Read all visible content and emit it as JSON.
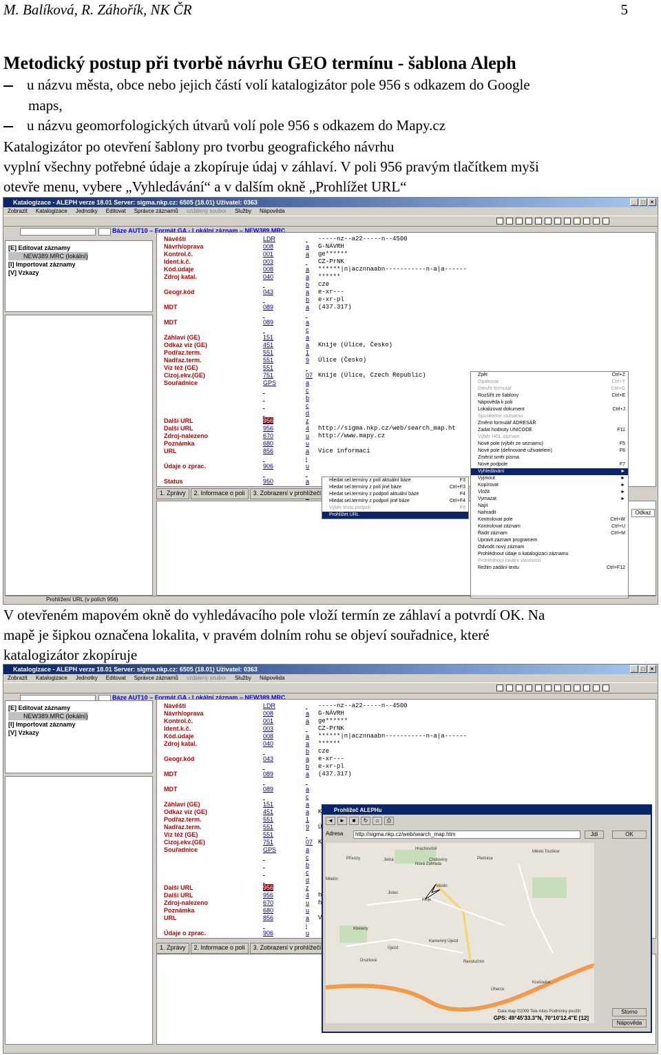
{
  "header": {
    "authors": "M. Balíková, R. Záhořík, NK ČR",
    "page_number": "5"
  },
  "title": "Metodický postup  při tvorbě návrhu GEO termínu - šablona Aleph",
  "bullets": [
    "u názvu města, obce nebo jejich částí volí katalogizátor pole 956 s odkazem do Google",
    "maps,",
    "u názvu geomorfologických útvarů volí pole 956 s odkazem do Mapy.cz"
  ],
  "paragraph1": [
    "Katalogizátor po otevření šablony pro tvorbu geografického návrhu",
    "vyplní všechny potřebné údaje a zkopíruje údaj v záhlaví. V poli 956 pravým tlačítkem myši",
    "otevře menu, vybere „Vyhledávání“ a v dalším okně „Prohlížet URL“"
  ],
  "paragraph2": [
    "V otevřeném mapovém okně do vyhledávacího pole vloží termín ze záhlaví a potvrdí OK. Na",
    "mapě je šipkou označena lokalita, v pravém dolním rohu se objeví souřadnice, které",
    "katalogizátor zkopíruje"
  ],
  "app": {
    "window_title": "Katalogizace - ALEPH verze 18.01  Server: sigma.nkp.cz: 6505 (18.01)  Uživatel: 0363",
    "menu": [
      "Zobrazit",
      "Katalogizace",
      "Jednotky",
      "Editovat",
      "Správce záznamů",
      "vzdálený soubor",
      "Služby",
      "Nápověda"
    ],
    "base_label": "Báze AUT10 – Formát GA - Lokální záznam – NEW389.MRC",
    "tree": [
      "[E] Editovat záznamy",
      "NEW389.MRC (lokální)",
      "[I] Importovat záznamy",
      "[V] Vzkazy"
    ],
    "tabs": [
      "1. Zprávy",
      "2. Informace o poli",
      "3. Zobrazení v prohlížeči"
    ],
    "status_text": "Prohlížení URL (v polích 956)",
    "fields": [
      "Návěští",
      "Návrh/oprava",
      "Kontrol.č.",
      "Ident.k.č.",
      "Kód.údaje",
      "Zdroj katal.",
      "",
      "Geogr.kód",
      "",
      "MDT",
      "",
      "MDT",
      "",
      "Záhlaví (GE)",
      "Odkaz viz (GE)",
      "Podřaz.term.",
      "Nadřaz.term.",
      "Viz též (GE)",
      "Cizoj.ekv.(GE)",
      "Souřadnice",
      "",
      "",
      "",
      "",
      "Další URL",
      "Další URL",
      "Zdroj-nalezeno",
      "Poznámka",
      "URL",
      "",
      "Údaje o zprac.",
      "",
      "Status"
    ],
    "codes": [
      "LDR",
      "008",
      "001",
      "003",
      "008",
      "040",
      "",
      "043",
      "",
      "089",
      "",
      "089",
      "",
      "151",
      "451",
      "551",
      "551",
      "551",
      "751",
      "GPS",
      "",
      "",
      "",
      "",
      "956",
      "956",
      "670",
      "680",
      "856",
      "",
      "906",
      "",
      "950"
    ],
    "subs": [
      "",
      "a",
      "a",
      "",
      "a",
      "a",
      "b",
      "a",
      "b",
      "a",
      "",
      "a",
      "c",
      "a",
      "a",
      "1",
      "9",
      "",
      "07",
      "a",
      "c",
      "b",
      "c",
      "d",
      "z",
      "4",
      "u",
      "u",
      "a",
      "i",
      "u",
      "",
      "a",
      "",
      "b"
    ],
    "values": [
      "-----nz--a22-----n--4500",
      "G-NÁVRH",
      "ge******",
      "CZ-PrNK",
      "******|n|acznnaabn-----------n-a|a------",
      "******",
      "cze",
      "e-xr---",
      "e-xr-pl",
      "(437.317)",
      "",
      "",
      "",
      "",
      "Knije (Úlice, Česko)",
      "",
      "Úlice (Česko)",
      "",
      "Knije (Úlice, Czech Republic)",
      "",
      "",
      "",
      "",
      "",
      "",
      "http://sigma.nkp.cz/web/search_map.ht",
      "http://www.mapy.cz",
      "",
      "Více informací"
    ],
    "context_menu": [
      {
        "label": "Zpět",
        "key": "Ctrl+Z"
      },
      {
        "label": "Opakovat",
        "key": "Ctrl+Y",
        "disabled": true
      },
      {
        "label": "Otevřít formulář",
        "key": "Ctrl+G",
        "disabled": true
      },
      {
        "label": "Rozšířit ze šablony",
        "key": "Ctrl+E"
      },
      {
        "label": "Nápověda k poli",
        "key": ""
      },
      {
        "label": "Lokalizovat dokument",
        "key": "Ctrl+J"
      },
      {
        "label": "Spustitelné záznamu",
        "key": "",
        "disabled": true
      },
      {
        "label": "Změnit formulář ADRESÁŘ",
        "key": ""
      },
      {
        "label": "Zadat hodnoty UNICODE",
        "key": "F11"
      },
      {
        "label": "Výběr HOL záznam",
        "key": "",
        "disabled": true
      },
      {
        "label": "Nové pole (výběr ze seznamu)",
        "key": "F5"
      },
      {
        "label": "Nové pole (definované uživatelem)",
        "key": "F6"
      },
      {
        "label": "Změnit směr písma",
        "key": ""
      },
      {
        "label": "Nové podpole",
        "key": "F7"
      },
      {
        "label": "Vyhledávání",
        "key": "►",
        "highlight": true
      },
      {
        "label": "Vyjmout",
        "key": "►"
      },
      {
        "label": "Kopírovat",
        "key": "►"
      },
      {
        "label": "Vložit",
        "key": "►"
      },
      {
        "label": "Vymazat",
        "key": "►"
      },
      {
        "label": "Najít",
        "key": ""
      },
      {
        "label": "Nahradit",
        "key": ""
      },
      {
        "label": "Kontrolovat pole",
        "key": "Ctrl+W"
      },
      {
        "label": "Kontrolovat záznam",
        "key": "Ctrl+U"
      },
      {
        "label": "Řadit záznam",
        "key": "Ctrl+M"
      },
      {
        "label": "Upravit záznam programem",
        "key": ""
      },
      {
        "label": "Odvodit nový záznam",
        "key": ""
      },
      {
        "label": "Prohlédnout údaje o katalogizaci záznamu",
        "key": ""
      },
      {
        "label": "Prohlédnout lokální vlastnosti",
        "key": "",
        "disabled": true
      },
      {
        "label": "Režim zadání textu",
        "key": "Ctrl+F12"
      }
    ],
    "submenu": [
      {
        "label": "Hledat sel.termíny z polí aktuální báze",
        "key": "F3"
      },
      {
        "label": "Hledat sel.termíny z polí jiné báze",
        "key": "Ctrl+F3"
      },
      {
        "label": "Hledat sel.termíny z podpolí aktuální báze",
        "key": "F4"
      },
      {
        "label": "Hledat sel.termíny z podpolí jiné báze",
        "key": "Ctrl+F4"
      },
      {
        "label": "Výběr textu podpolí",
        "key": "F8",
        "disabled": true
      },
      {
        "label": "Prohlížet URL",
        "key": "",
        "highlight": true
      }
    ],
    "odkaz_button": "Odkaz"
  },
  "browser": {
    "title": "Prohlížeč ALEPHu",
    "address_label": "Adresa",
    "address": "http://sigma.nkp.cz/web/search_map.htm",
    "go_button": "Jdi",
    "ok_button": "OK",
    "storno_button": "Storno",
    "help_button": "Nápověda",
    "gps": "GPS:   49°45'33.3\"N, 70°10'12.4\"E  [12]",
    "map_copyright": "Data map ©2009 Tele Atlas  Podmínky použití",
    "map_labels": [
      "Hrachoviště",
      "Chotoviny",
      "Jetná",
      "Nová Zahrada",
      "Přívozy",
      "Miletín",
      "Věstin",
      "Jistec",
      "Město Touškov",
      "Plešnice",
      "Kbelany",
      "Knije",
      "Kamenný Újezd",
      "Újezd",
      "Druztová",
      "Úherce",
      "Krašovice",
      "Revolučnín"
    ]
  }
}
